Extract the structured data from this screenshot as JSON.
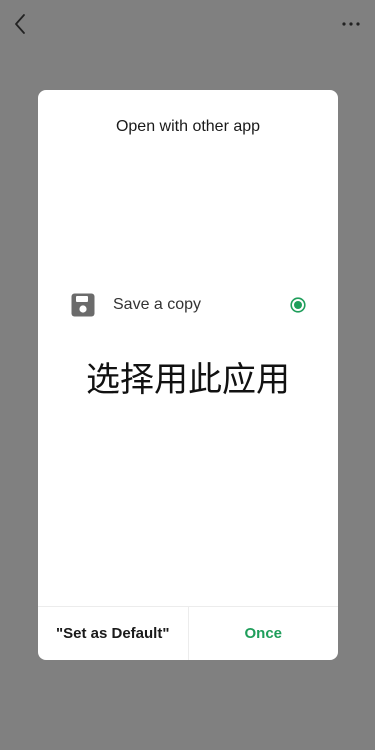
{
  "topbar": {
    "back_icon": "chevron-left-icon",
    "more_icon": "more-horizontal-icon"
  },
  "dialog": {
    "title": "Open with other app",
    "option": {
      "icon": "save-icon",
      "label": "Save a copy",
      "selected": true
    },
    "overlay_text": "选择用此应用",
    "buttons": {
      "set_default": "\"Set as Default\"",
      "once": "Once"
    }
  },
  "colors": {
    "accent": "#1f9e5b",
    "backdrop": "#808080",
    "dialog_bg": "#ffffff"
  }
}
